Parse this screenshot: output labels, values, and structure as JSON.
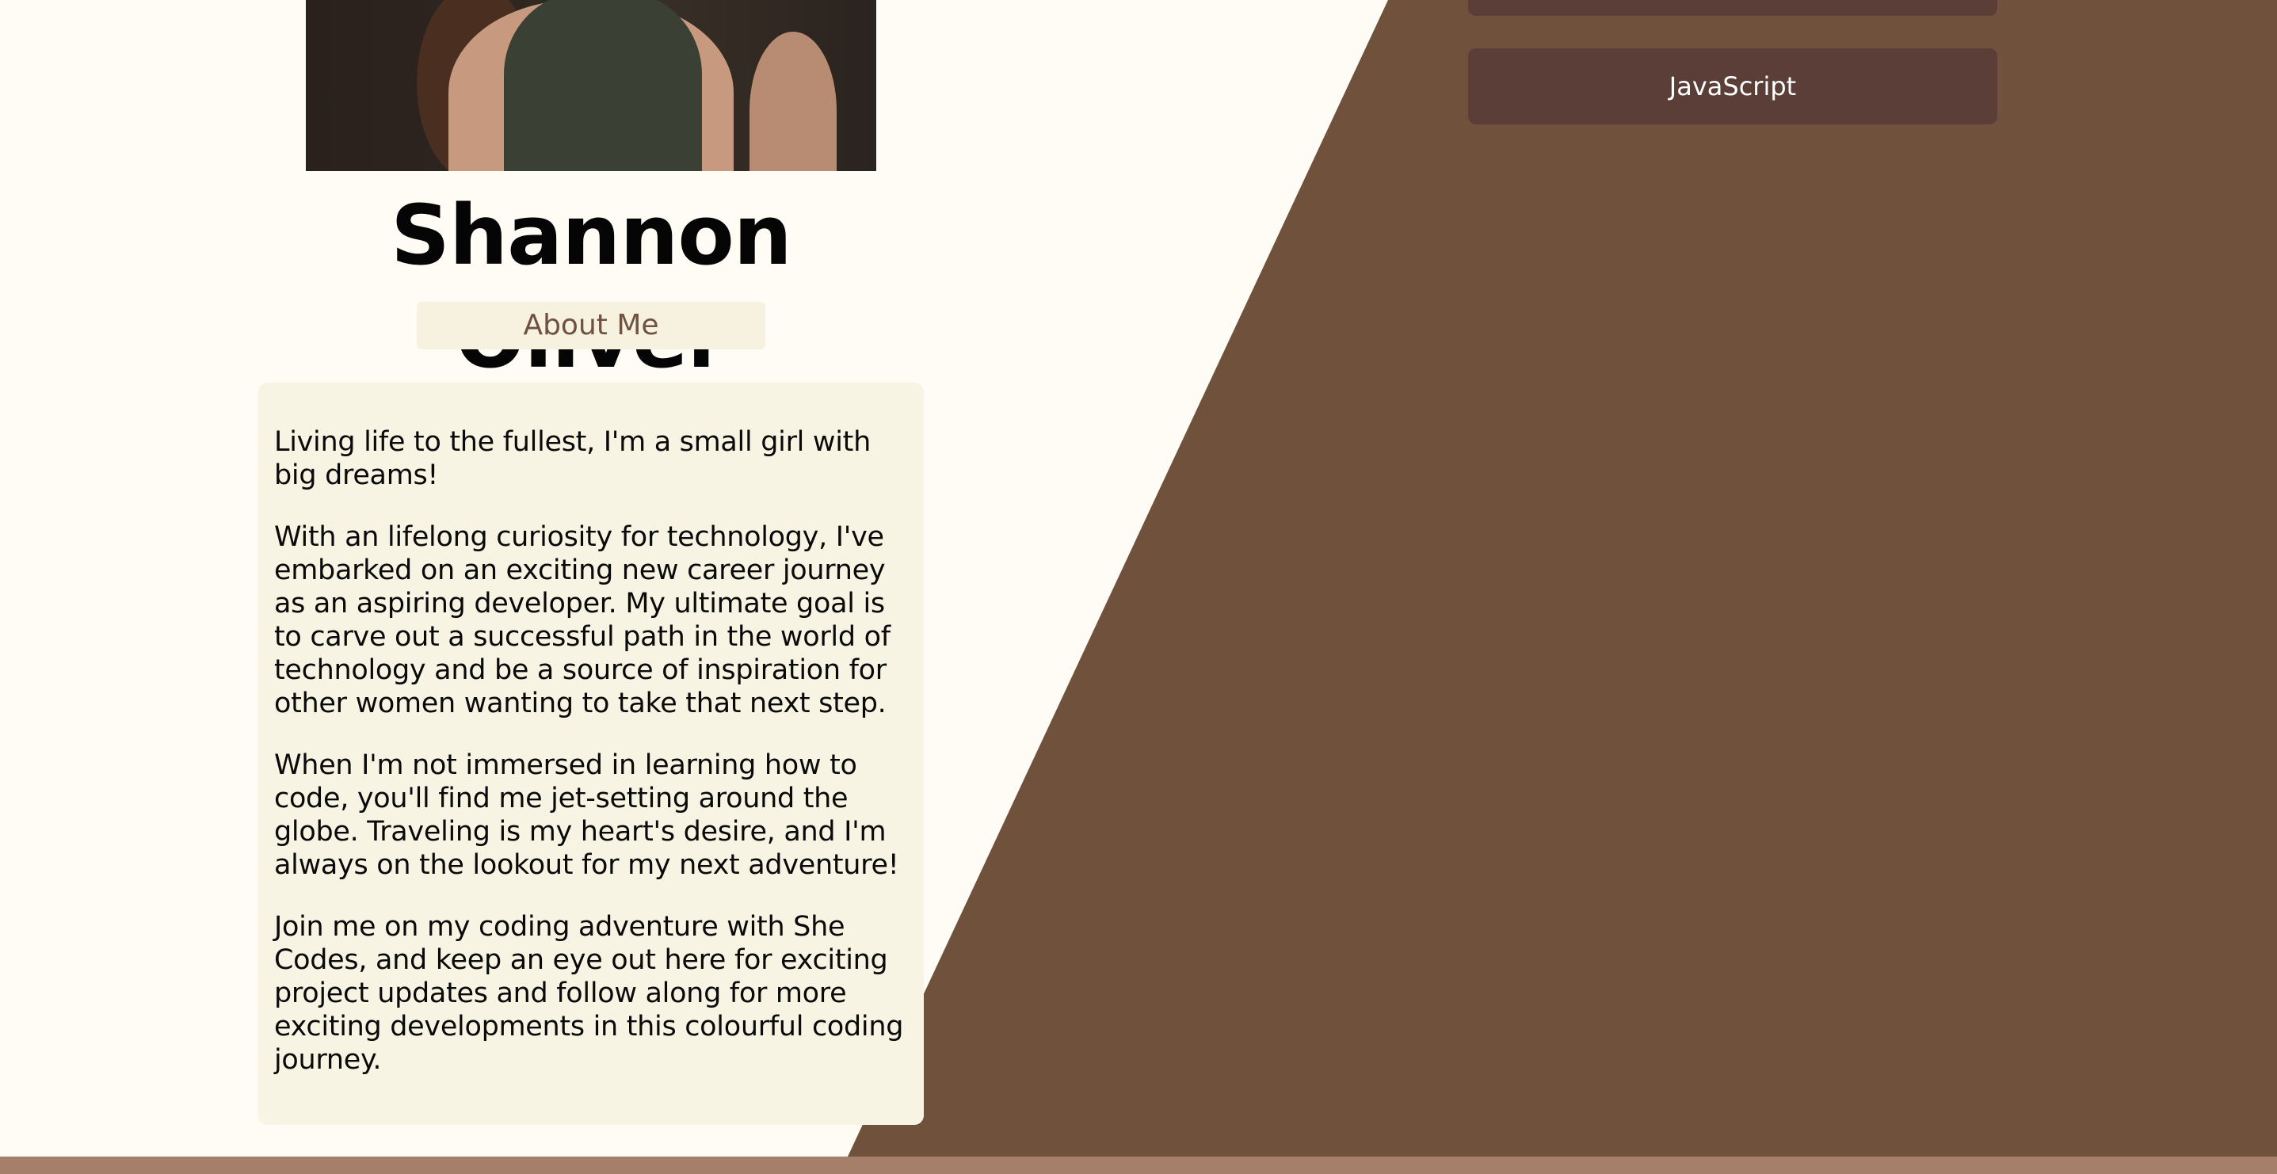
{
  "profile": {
    "name": "Shannon Oliver",
    "photo_alt": "Profile photo"
  },
  "about": {
    "heading": "About Me",
    "paragraphs": [
      "Living life to the fullest, I'm a small girl with big dreams!",
      "With an lifelong curiosity for technology, I've embarked on an exciting new career journey as an aspiring developer. My ultimate goal is to carve out a successful path in the world of technology and be a source of inspiration for other women wanting to take that next step.",
      "When I'm not immersed in learning how to code, you'll find me jet-setting around the globe. Traveling is my heart's desire, and I'm always on the lookout for my next adventure!",
      "Join me on my coding adventure with She Codes, and keep an eye out here for exciting project updates and follow along for more exciting developments in this colourful coding journey."
    ]
  },
  "skills": {
    "items": [
      "",
      "JavaScript"
    ]
  },
  "colors": {
    "background": "#fefcf5",
    "accent_brown": "#6f513c",
    "button_brown": "#5a3e37",
    "card_cream": "#f8f4e4",
    "footer_bar": "#a57f6a"
  }
}
